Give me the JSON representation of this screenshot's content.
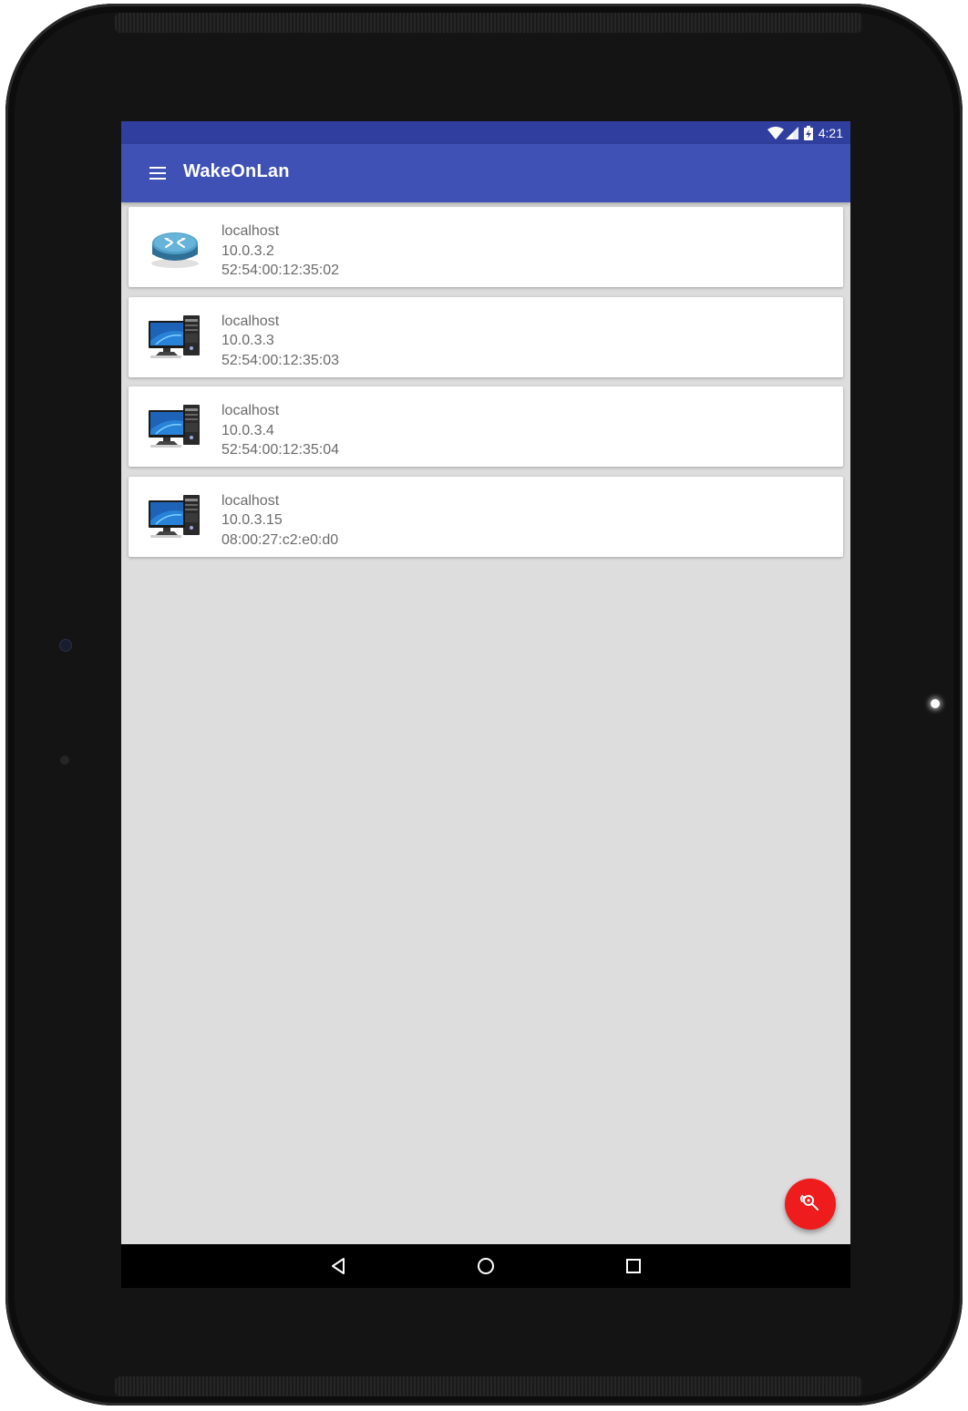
{
  "status_bar": {
    "time": "4:21",
    "icons": [
      "wifi-icon",
      "cell-signal-icon",
      "battery-charging-icon"
    ]
  },
  "app_bar": {
    "menu_icon": "hamburger-menu-icon",
    "title": "WakeOnLan"
  },
  "devices": [
    {
      "icon": "router-icon",
      "hostname": "localhost",
      "ip": "10.0.3.2",
      "mac": "52:54:00:12:35:02"
    },
    {
      "icon": "computer-icon",
      "hostname": "localhost",
      "ip": "10.0.3.3",
      "mac": "52:54:00:12:35:03"
    },
    {
      "icon": "computer-icon",
      "hostname": "localhost",
      "ip": "10.0.3.4",
      "mac": "52:54:00:12:35:04"
    },
    {
      "icon": "computer-icon",
      "hostname": "localhost",
      "ip": "10.0.3.15",
      "mac": "08:00:27:c2:e0:d0"
    }
  ],
  "fab": {
    "icon": "network-search-icon",
    "color": "#ee1c1c"
  },
  "nav_bar": {
    "icons": [
      "back-icon",
      "home-icon",
      "recents-icon"
    ]
  },
  "colors": {
    "status_bar": "#303f9f",
    "app_bar": "#3f51b5",
    "background": "#dddddd",
    "card": "#ffffff",
    "text_secondary": "#6b6b6b"
  }
}
